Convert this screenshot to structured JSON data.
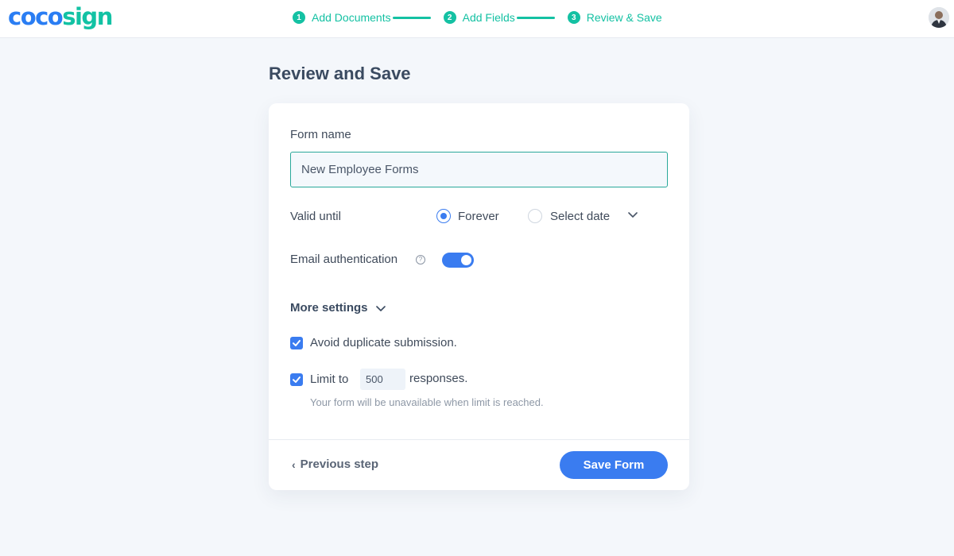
{
  "header": {
    "logo": {
      "part1": "coco",
      "part2": "sign"
    },
    "steps": [
      {
        "num": "1",
        "label": "Add Documents"
      },
      {
        "num": "2",
        "label": "Add Fields"
      },
      {
        "num": "3",
        "label": "Review & Save"
      }
    ],
    "avatar_icon": "user-avatar"
  },
  "page": {
    "title": "Review and Save"
  },
  "form": {
    "name_label": "Form name",
    "name_value": "New Employee Forms",
    "valid_until_label": "Valid until",
    "valid_options": [
      {
        "label": "Forever",
        "selected": true
      },
      {
        "label": "Select date",
        "selected": false
      }
    ],
    "email_auth_label": "Email authentication",
    "email_auth_enabled": true,
    "more_settings_label": "More settings",
    "avoid_duplicate_label": "Avoid duplicate submission.",
    "avoid_duplicate_checked": true,
    "limit_prefix": "Limit to",
    "limit_value": "500",
    "limit_suffix": "responses.",
    "limit_checked": true,
    "limit_hint": "Your form will be unavailable when limit is reached."
  },
  "footer": {
    "prev_label": "Previous step",
    "save_label": "Save Form"
  },
  "colors": {
    "accent": "#3a7cf0",
    "brand_teal": "#14c1a3",
    "background": "#f4f7fb"
  }
}
